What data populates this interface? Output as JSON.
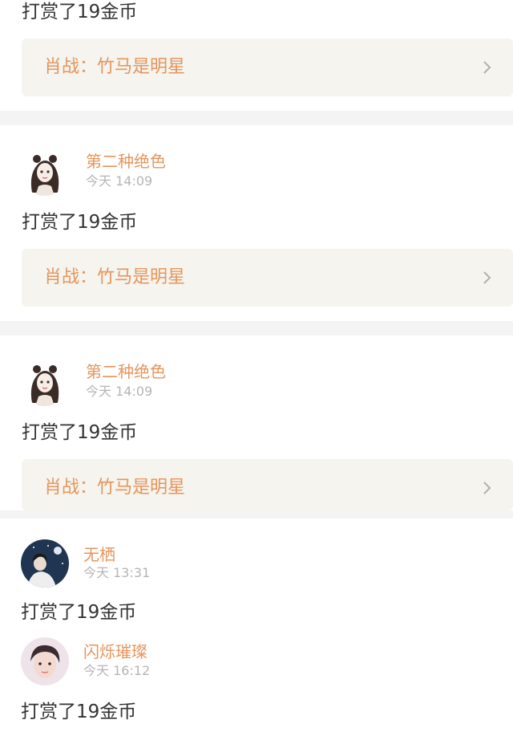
{
  "top_partial": {
    "message": "打赏了19金币",
    "link_text": "肖战：竹马是明星"
  },
  "entries": [
    {
      "name": "第二种绝色",
      "time": "今天 14:09",
      "message": "打赏了19金币",
      "link_text": "肖战：竹马是明星",
      "avatar": "girl-sketch-avatar"
    },
    {
      "name": "第二种绝色",
      "time": "今天 14:09",
      "message": "打赏了19金币",
      "link_text": "肖战：竹马是明星",
      "avatar": "girl-sketch-avatar"
    }
  ],
  "bottom_entries": [
    {
      "name": "无栖",
      "time": "今天 13:31",
      "message": "打赏了19金币",
      "avatar": "night-scene-avatar"
    },
    {
      "name": "闪烁璀璨",
      "time": "今天 16:12",
      "message": "打赏了19金币",
      "avatar": "portrait-avatar"
    }
  ],
  "colors": {
    "accent": "#e6955c",
    "card_bg": "#f5f4ee",
    "separator": "#f4f4f4",
    "text": "#333333",
    "muted": "#b5b5b5"
  }
}
